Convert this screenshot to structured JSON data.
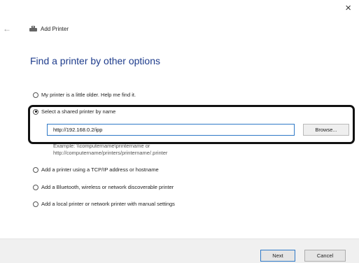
{
  "window": {
    "title": "Add Printer",
    "close_glyph": "×",
    "back_glyph": "←"
  },
  "page": {
    "heading": "Find a printer by other options"
  },
  "options": [
    {
      "label": "My printer is a little older. Help me find it.",
      "checked": false
    },
    {
      "label": "Select a shared printer by name",
      "checked": true
    },
    {
      "label": "Add a printer using a TCP/IP address or hostname",
      "checked": false
    },
    {
      "label": "Add a Bluetooth, wireless or network discoverable printer",
      "checked": false
    },
    {
      "label": "Add a local printer or network printer with manual settings",
      "checked": false
    }
  ],
  "shared_printer": {
    "input_value": "http://192.168.0.2/ipp",
    "browse_label": "Browse...",
    "example_line1": "Example: \\\\computername\\printername or",
    "example_line2": "http://computername/printers/printername/.printer"
  },
  "footer": {
    "next_label": "Next",
    "cancel_label": "Cancel"
  },
  "colors": {
    "heading": "#1e3c8c",
    "input_border": "#2f79c7",
    "footer_bg": "#f0f0f0"
  }
}
